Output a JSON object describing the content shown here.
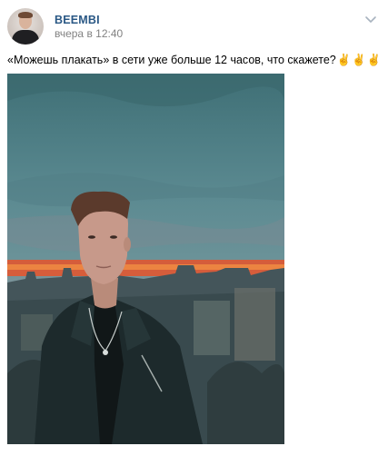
{
  "post": {
    "author": "BEEMBI",
    "time": "вчера в 12:40",
    "text": "«Можешь плакать» в сети уже больше 12 часов, что скажете?",
    "emojis": [
      "✌️",
      "✌️",
      "✌️"
    ]
  },
  "icons": {
    "more": "chevron-down-icon"
  },
  "colors": {
    "author": "#2a5885",
    "time": "#828282",
    "sunset": "#e8542a"
  }
}
